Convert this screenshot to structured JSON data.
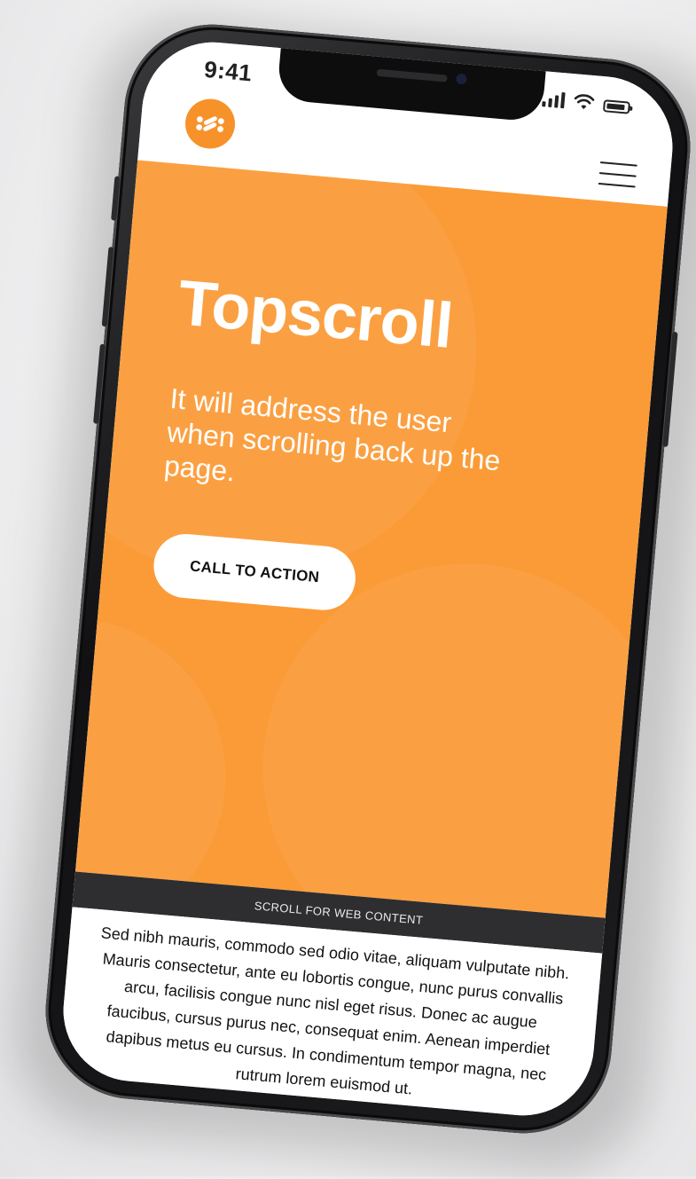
{
  "status_bar": {
    "time": "9:41",
    "icons": [
      "signal-icon",
      "wifi-icon",
      "battery-icon"
    ]
  },
  "header": {
    "logo_icon": "brand-logo-icon",
    "menu_icon": "hamburger-menu-icon"
  },
  "hero": {
    "title": "Topscroll",
    "subtitle": "It will address the user when scrolling back up the page.",
    "cta_label": "CALL TO ACTION",
    "background_color": "#fb9b37"
  },
  "scroll_bar": {
    "label": "SCROLL FOR WEB CONTENT"
  },
  "content": {
    "body": "Sed nibh mauris, commodo sed odio vitae, aliquam vulputate nibh. Mauris consectetur, ante eu lobortis congue, nunc purus convallis arcu, facilisis congue nunc nisl eget risus. Donec ac augue faucibus, cursus purus nec, consequat enim. Aenean imperdiet dapibus metus eu cursus. In condimentum tempor magna, nec rutrum lorem euismod ut."
  },
  "colors": {
    "accent": "#f7922a",
    "dark_bar": "#2e2e30",
    "device_frame": "#1c1c1e"
  }
}
